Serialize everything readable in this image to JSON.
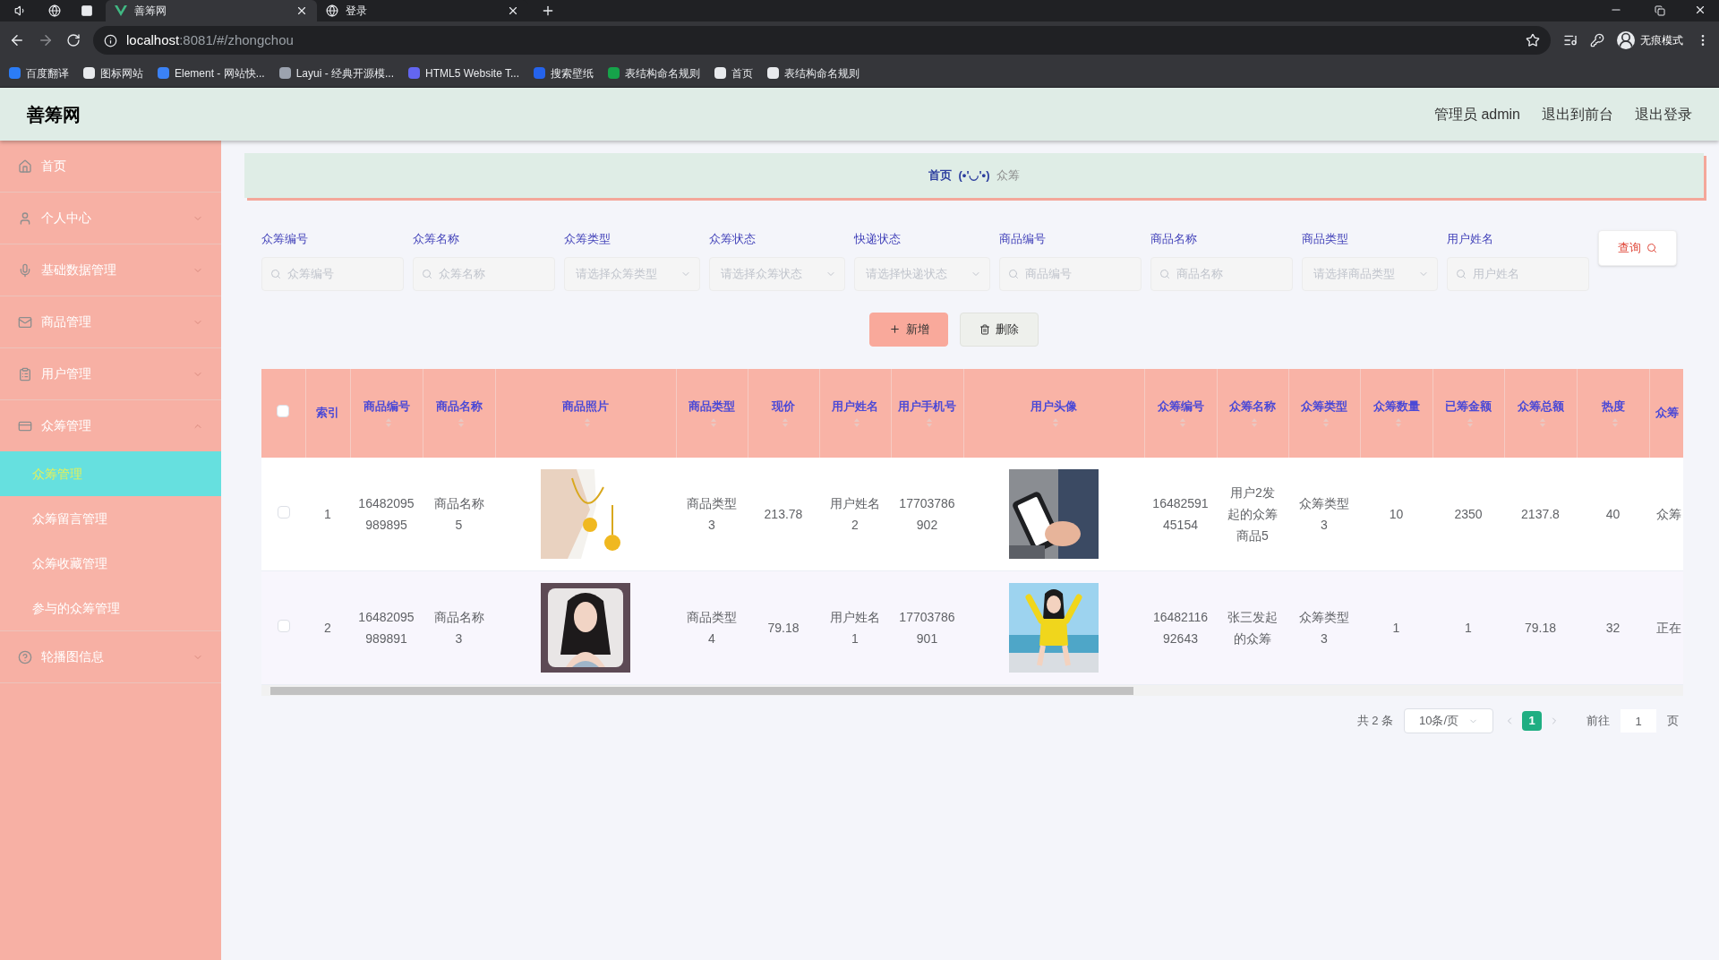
{
  "browser": {
    "tabs": [
      {
        "title": "善筹网",
        "selected": true
      },
      {
        "title": "登录",
        "selected": false
      }
    ],
    "url_host": "localhost",
    "url_rest": ":8081/#/zhongchou",
    "profile_label": "无痕模式",
    "bookmarks": [
      "百度翻译",
      "图标网站",
      "Element - 网站快...",
      "Layui - 经典开源模...",
      "HTML5 Website T...",
      "搜索壁纸",
      "表结构命名规则",
      "首页",
      "表结构命名规则"
    ]
  },
  "app": {
    "title": "善筹网",
    "header_links": [
      "管理员 admin",
      "退出到前台",
      "退出登录"
    ]
  },
  "sidebar": {
    "items": [
      {
        "label": "首页"
      },
      {
        "label": "个人中心",
        "expanded": false
      },
      {
        "label": "基础数据管理",
        "expanded": false
      },
      {
        "label": "商品管理",
        "expanded": false
      },
      {
        "label": "用户管理",
        "expanded": false
      },
      {
        "label": "众筹管理",
        "expanded": true,
        "children": [
          {
            "label": "众筹管理",
            "selected": true
          },
          {
            "label": "众筹留言管理",
            "selected": false
          },
          {
            "label": "众筹收藏管理",
            "selected": false
          },
          {
            "label": "参与的众筹管理",
            "selected": false
          }
        ]
      },
      {
        "label": "轮播图信息",
        "expanded": false
      }
    ]
  },
  "breadcrumb": {
    "items": [
      "首页",
      "众筹"
    ],
    "separator": "(•'◡'•)"
  },
  "filters": [
    {
      "label": "众筹编号",
      "kind": "input",
      "placeholder": "众筹编号"
    },
    {
      "label": "众筹名称",
      "kind": "input",
      "placeholder": "众筹名称"
    },
    {
      "label": "众筹类型",
      "kind": "select",
      "placeholder": "请选择众筹类型"
    },
    {
      "label": "众筹状态",
      "kind": "select",
      "placeholder": "请选择众筹状态"
    },
    {
      "label": "快递状态",
      "kind": "select",
      "placeholder": "请选择快递状态"
    },
    {
      "label": "商品编号",
      "kind": "input",
      "placeholder": "商品编号"
    },
    {
      "label": "商品名称",
      "kind": "input",
      "placeholder": "商品名称"
    },
    {
      "label": "商品类型",
      "kind": "select",
      "placeholder": "请选择商品类型"
    },
    {
      "label": "用户姓名",
      "kind": "input",
      "placeholder": "用户姓名"
    }
  ],
  "search_button": "查询",
  "actions": [
    {
      "label": "新增",
      "kind": "add"
    },
    {
      "label": "删除",
      "kind": "delete"
    }
  ],
  "table": {
    "header_checked": false,
    "columns": [
      {
        "label": "索引",
        "sortable": false,
        "kind": "text"
      },
      {
        "label": "商品编号",
        "sortable": true,
        "kind": "text"
      },
      {
        "label": "商品名称",
        "sortable": true,
        "kind": "text"
      },
      {
        "label": "商品照片",
        "sortable": true,
        "kind": "picture"
      },
      {
        "label": "商品类型",
        "sortable": true,
        "kind": "text"
      },
      {
        "label": "现价",
        "sortable": true,
        "kind": "text"
      },
      {
        "label": "用户姓名",
        "sortable": true,
        "kind": "text"
      },
      {
        "label": "用户手机号",
        "sortable": true,
        "kind": "text"
      },
      {
        "label": "用户头像",
        "sortable": true,
        "kind": "picture"
      },
      {
        "label": "众筹编号",
        "sortable": true,
        "kind": "text"
      },
      {
        "label": "众筹名称",
        "sortable": true,
        "kind": "text"
      },
      {
        "label": "众筹类型",
        "sortable": true,
        "kind": "text"
      },
      {
        "label": "众筹数量",
        "sortable": true,
        "kind": "text"
      },
      {
        "label": "已筹金额",
        "sortable": true,
        "kind": "text"
      },
      {
        "label": "众筹总额",
        "sortable": true,
        "kind": "text"
      },
      {
        "label": "热度",
        "sortable": true,
        "kind": "text"
      },
      {
        "label": "众筹",
        "sortable": false,
        "kind": "text"
      }
    ],
    "rows": [
      {
        "checked": false,
        "cells": [
          "1",
          "16482095989895",
          "商品名称5",
          "",
          "商品类型3",
          "213.78",
          "用户姓名2",
          "17703786902",
          "",
          "1648259145154",
          "用户2发起的众筹商品5",
          "众筹类型3",
          "10",
          "2350",
          "2137.8",
          "40",
          "众筹"
        ]
      },
      {
        "checked": false,
        "cells": [
          "2",
          "16482095989891",
          "商品名称3",
          "",
          "商品类型4",
          "79.18",
          "用户姓名1",
          "17703786901",
          "",
          "1648211692643",
          "张三发起的众筹",
          "众筹类型3",
          "1",
          "1",
          "79.18",
          "32",
          "正在"
        ]
      }
    ]
  },
  "pagination": {
    "total": "共 2 条",
    "page_size": "10条/页",
    "pages": [
      {
        "label": "1",
        "selected": true
      }
    ],
    "goto_label": "前往",
    "goto_value": "1",
    "goto_suffix": "页"
  }
}
